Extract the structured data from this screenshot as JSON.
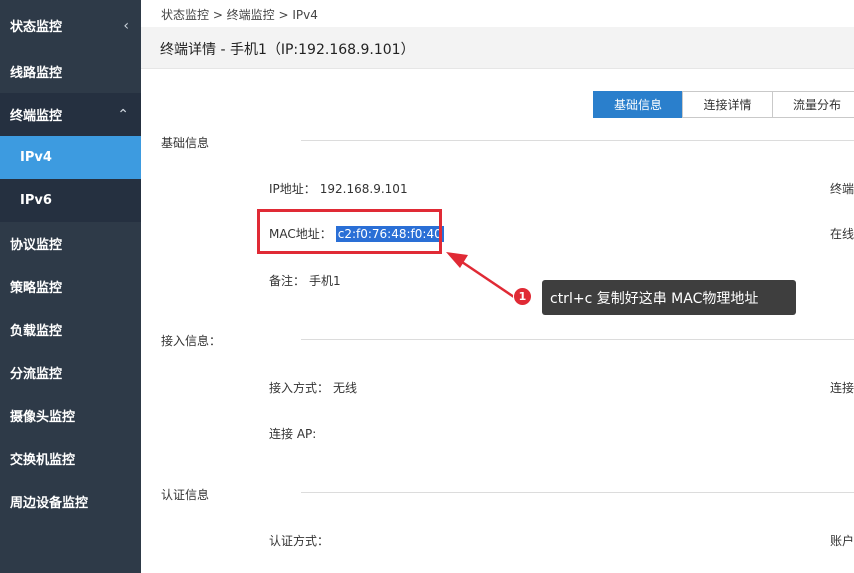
{
  "sidebar": {
    "items": [
      {
        "label": "状态监控",
        "chevron": "<"
      },
      {
        "label": "线路监控"
      },
      {
        "label": "终端监控",
        "chevron": "^"
      },
      {
        "label": "IPv4"
      },
      {
        "label": "IPv6"
      },
      {
        "label": "协议监控"
      },
      {
        "label": "策略监控"
      },
      {
        "label": "负载监控"
      },
      {
        "label": "分流监控"
      },
      {
        "label": "摄像头监控"
      },
      {
        "label": "交换机监控"
      },
      {
        "label": "周边设备监控"
      }
    ]
  },
  "breadcrumb": "状态监控 > 终端监控 > IPv4",
  "page_title": "终端详情 - 手机1（IP:192.168.9.101）",
  "tabs": [
    "基础信息",
    "连接详情",
    "流量分布"
  ],
  "sections": {
    "basic": {
      "label": "基础信息",
      "ip_label": "IP地址：",
      "ip_value": "192.168.9.101",
      "mac_label": "MAC地址：",
      "mac_value": "c2:f0:76:48:f0:40",
      "note_label": "备注：",
      "note_value": "手机1",
      "right_1": "终端",
      "right_2": "在线"
    },
    "access": {
      "label": "接入信息：",
      "method_label": "接入方式：",
      "method_value": "无线",
      "ap_label": "连接 AP:",
      "right_1": "连接"
    },
    "auth": {
      "label": "认证信息",
      "method_label": "认证方式：",
      "right_1": "账户"
    }
  },
  "annotation": {
    "badge": "1",
    "text": "ctrl+c 复制好这串 MAC物理地址"
  },
  "colors": {
    "sidebar_bg": "#2e3a48",
    "active_blue": "#3d9be0",
    "tab_active": "#2a7fcc",
    "highlight_red": "#e02a35"
  }
}
